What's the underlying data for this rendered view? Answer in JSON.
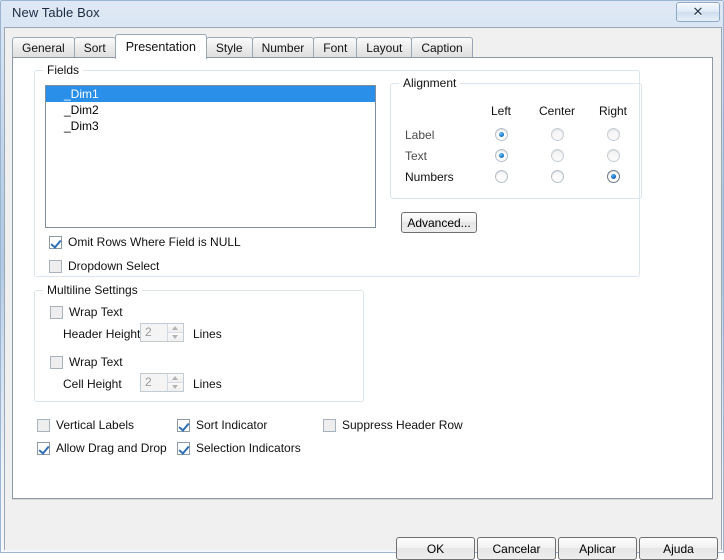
{
  "window": {
    "title": "New Table Box",
    "close_label": "✕",
    "close_icon": "close-icon"
  },
  "tabs": [
    {
      "label": "General",
      "active": false
    },
    {
      "label": "Sort",
      "active": false
    },
    {
      "label": "Presentation",
      "active": true
    },
    {
      "label": "Style",
      "active": false
    },
    {
      "label": "Number",
      "active": false
    },
    {
      "label": "Font",
      "active": false
    },
    {
      "label": "Layout",
      "active": false
    },
    {
      "label": "Caption",
      "active": false
    }
  ],
  "fields_group": {
    "title": "Fields",
    "list": [
      {
        "label": "_Dim1",
        "selected": true
      },
      {
        "label": "_Dim2",
        "selected": false
      },
      {
        "label": "_Dim3",
        "selected": false
      }
    ],
    "omit_rows": {
      "label": "Omit Rows Where Field is NULL",
      "checked": true
    },
    "dropdown_select": {
      "label": "Dropdown Select",
      "checked": false
    },
    "advanced_button": "Advanced..."
  },
  "alignment": {
    "title": "Alignment",
    "columns": [
      "Left",
      "Center",
      "Right"
    ],
    "rows": [
      {
        "label": "Label",
        "selected": "Left",
        "enabled": false
      },
      {
        "label": "Text",
        "selected": "Left",
        "enabled": false
      },
      {
        "label": "Numbers",
        "selected": "Right",
        "enabled": true
      }
    ]
  },
  "multiline": {
    "title": "Multiline Settings",
    "header_wrap": {
      "label": "Wrap Text",
      "checked": false
    },
    "header_height": {
      "label": "Header Height",
      "value": "2",
      "unit": "Lines"
    },
    "cell_wrap": {
      "label": "Wrap Text",
      "checked": false
    },
    "cell_height": {
      "label": "Cell Height",
      "value": "2",
      "unit": "Lines"
    }
  },
  "options": [
    {
      "label": "Vertical Labels",
      "checked": false
    },
    {
      "label": "Sort Indicator",
      "checked": true
    },
    {
      "label": "Suppress Header Row",
      "checked": false
    },
    {
      "label": "Allow Drag and Drop",
      "checked": true
    },
    {
      "label": "Selection Indicators",
      "checked": true
    }
  ],
  "footer": {
    "ok": "OK",
    "cancel": "Cancelar",
    "apply": "Aplicar",
    "help": "Ajuda"
  },
  "colors": {
    "selection_blue": "#2a8fe8",
    "radio_blue": "#0a63b5",
    "check_blue": "#2f6fb5",
    "panel": "#f0f0f0"
  }
}
